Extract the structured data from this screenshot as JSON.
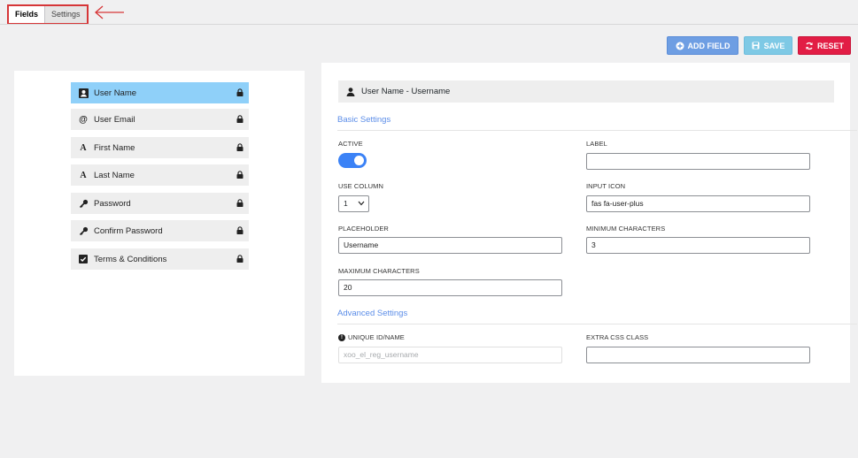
{
  "tabs": [
    {
      "label": "Fields",
      "active": true
    },
    {
      "label": "Settings",
      "active": false
    }
  ],
  "actions": {
    "add_field": "ADD FIELD",
    "save": "SAVE",
    "reset": "RESET"
  },
  "fields": [
    {
      "label": "User Name",
      "icon": "user-icon",
      "active": true
    },
    {
      "label": "User Email",
      "icon": "at-icon",
      "active": false
    },
    {
      "label": "First Name",
      "icon": "text-icon",
      "active": false
    },
    {
      "label": "Last Name",
      "icon": "text-icon",
      "active": false
    },
    {
      "label": "Password",
      "icon": "key-icon",
      "active": false
    },
    {
      "label": "Confirm Password",
      "icon": "key-icon",
      "active": false
    },
    {
      "label": "Terms & Conditions",
      "icon": "checkbox-icon",
      "active": false
    }
  ],
  "editor": {
    "header": "User Name - Username",
    "basic_title": "Basic Settings",
    "advanced_title": "Advanced Settings",
    "active_label": "ACTIVE",
    "active": true,
    "label_label": "LABEL",
    "label_value": "",
    "use_column_label": "USE COLUMN",
    "use_column_value": "1",
    "input_icon_label": "INPUT ICON",
    "input_icon_value": "fas fa-user-plus",
    "placeholder_label": "PLACEHOLDER",
    "placeholder_value": "Username",
    "min_chars_label": "MINIMUM CHARACTERS",
    "min_chars_value": "3",
    "max_chars_label": "MAXIMUM CHARACTERS",
    "max_chars_value": "20",
    "unique_id_label": "UNIQUE ID/NAME",
    "unique_id_value": "xoo_el_reg_username",
    "extra_css_label": "EXTRA CSS CLASS",
    "extra_css_value": ""
  },
  "colors": {
    "accent_blue": "#6e9ee3",
    "save_blue": "#7ec9e5",
    "reset_red": "#e21d45",
    "active_field": "#8fd0f9",
    "highlight_red": "#d63638"
  }
}
